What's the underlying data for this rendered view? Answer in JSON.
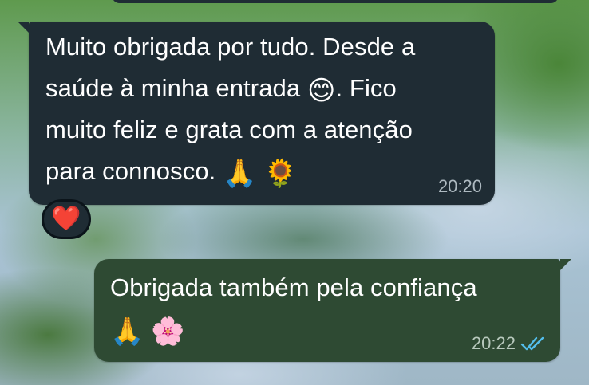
{
  "chat": {
    "incoming": {
      "lines": [
        "Muito obrigada por tudo. Desde a",
        "saúde à minha entrada",
        ". Fico",
        "muito feliz e grata com a atenção",
        "para connosco."
      ],
      "emoji_smile": "😊",
      "emoji_pray": "🙏",
      "emoji_sunflower": "🌻",
      "time": "20:20",
      "reaction": "❤️"
    },
    "outgoing": {
      "line1": "Obrigada também pela confiança",
      "emoji_pray": "🙏",
      "emoji_blossom": "🌸",
      "time": "20:22",
      "status_icon": "double-check-read-icon",
      "status_color": "#53bdeb"
    }
  },
  "colors": {
    "incoming_bubble": "#1f2c34",
    "outgoing_bubble": "#2e4a33",
    "text": "#ffffff",
    "timestamp": "#aebac1"
  }
}
